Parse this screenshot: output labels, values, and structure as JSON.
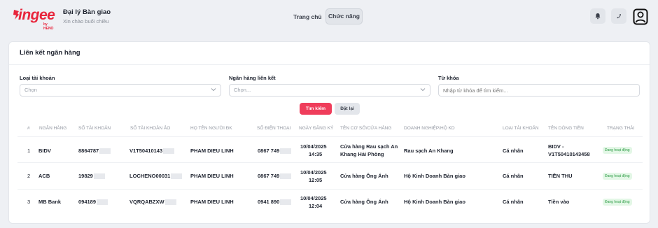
{
  "header": {
    "logo_text": "ingee",
    "logo_sub": "by HENO",
    "agent_name": "Đại lý Bàn giao",
    "greeting": "Xin chào buổi chiều",
    "nav": [
      "Trang chủ",
      "Chức năng"
    ]
  },
  "page": {
    "title": "Liên kết ngân hàng",
    "filters": {
      "account_type_label": "Loại tài khoản",
      "account_type_placeholder": "Chọn",
      "bank_label": "Ngân hàng liên kết",
      "bank_placeholder": "Chọn...",
      "keyword_label": "Từ khóa",
      "keyword_placeholder": "Nhập từ khóa để tìm kiếm..."
    },
    "search_button": "Tìm kiếm",
    "reset_button": "Đặt lại"
  },
  "table": {
    "headers": [
      "#",
      "NGÂN HÀNG",
      "SỐ TÀI KHOẢN",
      "SỐ TÀI KHOẢN ẢO",
      "HỌ TÊN NGƯỜI ĐK",
      "SỐ ĐIỆN THOẠI",
      "NGÀY ĐĂNG KÝ",
      "TÊN CƠ SỞ/CỬA HÀNG",
      "DOANH NGHIỆP/HỘ KD",
      "LOẠI TÀI KHOẢN",
      "TÊN DÒNG TIỀN",
      "TRẠNG THÁI"
    ],
    "rows": [
      {
        "index": "1",
        "bank": "BIDV",
        "account": "8864787",
        "virtual_account": "V1T50410143",
        "name": "PHAM DIEU LINH",
        "phone": "0867 749",
        "date": "10/04/2025",
        "time": "14:35",
        "store_line1": "Cửa hàng Rau sạch An",
        "store_line2": "Khang Hải Phòng",
        "business": "Rau sạch An Khang",
        "account_type": "Cá nhân",
        "flow_line1": "BIDV -",
        "flow_line2": "V1T50410143458",
        "status": "Đang hoạt động"
      },
      {
        "index": "2",
        "bank": "ACB",
        "account": "19829",
        "virtual_account": "LOCHENO00031",
        "name": "PHAM DIEU LINH",
        "phone": "0867 749",
        "date": "10/04/2025",
        "time": "12:05",
        "store_line1": "Cửa hàng Ông Ánh",
        "store_line2": "",
        "business": "Hộ Kinh Doanh Bàn giao",
        "account_type": "Cá nhân",
        "flow_line1": "TIỀN THU",
        "flow_line2": "",
        "status": "Đang hoạt động"
      },
      {
        "index": "3",
        "bank": "MB Bank",
        "account": "094189",
        "virtual_account": "VQRQABZXW",
        "name": "PHAM DIEU LINH",
        "phone": "0941 890",
        "date": "10/04/2025",
        "time": "12:04",
        "store_line1": "Cửa hàng Ông Ánh",
        "store_line2": "",
        "business": "Hộ Kinh Doanh Bàn giao",
        "account_type": "Cá nhân",
        "flow_line1": "Tiền vào",
        "flow_line2": "",
        "status": "Đang hoạt động"
      }
    ]
  },
  "colors": {
    "brand": "#e8253c",
    "primary_button": "#ef3d5b",
    "status_bg": "#e3f7e6",
    "status_text": "#2e9c46"
  },
  "icons": [
    "bell-icon",
    "phone-icon",
    "user-avatar-icon",
    "chevron-down-icon"
  ]
}
